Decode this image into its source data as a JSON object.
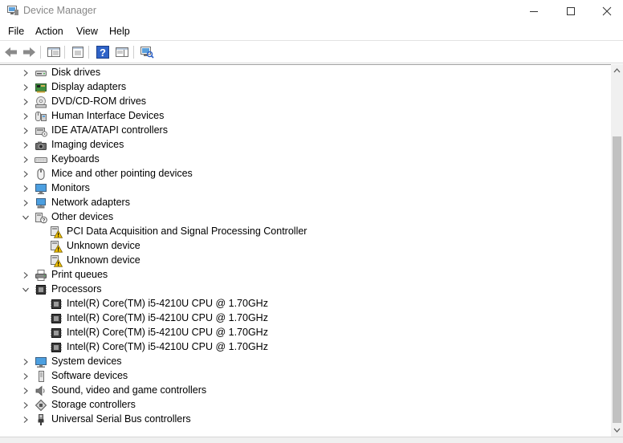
{
  "window": {
    "title": "Device Manager",
    "app_icon": "device-manager-icon"
  },
  "menu": [
    {
      "label": "File"
    },
    {
      "label": "Action"
    },
    {
      "label": "View"
    },
    {
      "label": "Help"
    }
  ],
  "toolbar": {
    "buttons": [
      "back-arrow-icon",
      "forward-arrow-icon",
      "show-hide-console-tree-icon",
      "properties-icon",
      "help-icon",
      "action-pane-icon",
      "scan-hardware-icon"
    ]
  },
  "tree": [
    {
      "label": "Disk drives",
      "expanded": false,
      "level": 0,
      "icon": "disk-drive-icon"
    },
    {
      "label": "Display adapters",
      "expanded": false,
      "level": 0,
      "icon": "display-adapter-icon"
    },
    {
      "label": "DVD/CD-ROM drives",
      "expanded": false,
      "level": 0,
      "icon": "dvd-drive-icon"
    },
    {
      "label": "Human Interface Devices",
      "expanded": false,
      "level": 0,
      "icon": "hid-icon"
    },
    {
      "label": "IDE ATA/ATAPI controllers",
      "expanded": false,
      "level": 0,
      "icon": "ide-controller-icon"
    },
    {
      "label": "Imaging devices",
      "expanded": false,
      "level": 0,
      "icon": "camera-icon"
    },
    {
      "label": "Keyboards",
      "expanded": false,
      "level": 0,
      "icon": "keyboard-icon"
    },
    {
      "label": "Mice and other pointing devices",
      "expanded": false,
      "level": 0,
      "icon": "mouse-icon"
    },
    {
      "label": "Monitors",
      "expanded": false,
      "level": 0,
      "icon": "monitor-icon"
    },
    {
      "label": "Network adapters",
      "expanded": false,
      "level": 0,
      "icon": "network-adapter-icon"
    },
    {
      "label": "Other devices",
      "expanded": true,
      "level": 0,
      "icon": "other-devices-icon"
    },
    {
      "label": "PCI Data Acquisition and Signal Processing Controller",
      "level": 1,
      "icon": "warning-device-icon"
    },
    {
      "label": "Unknown device",
      "level": 1,
      "icon": "warning-device-icon"
    },
    {
      "label": "Unknown device",
      "level": 1,
      "icon": "warning-device-icon"
    },
    {
      "label": "Print queues",
      "expanded": false,
      "level": 0,
      "icon": "printer-icon"
    },
    {
      "label": "Processors",
      "expanded": true,
      "level": 0,
      "icon": "processor-icon"
    },
    {
      "label": "Intel(R) Core(TM) i5-4210U CPU @ 1.70GHz",
      "level": 1,
      "icon": "processor-icon"
    },
    {
      "label": "Intel(R) Core(TM) i5-4210U CPU @ 1.70GHz",
      "level": 1,
      "icon": "processor-icon"
    },
    {
      "label": "Intel(R) Core(TM) i5-4210U CPU @ 1.70GHz",
      "level": 1,
      "icon": "processor-icon"
    },
    {
      "label": "Intel(R) Core(TM) i5-4210U CPU @ 1.70GHz",
      "level": 1,
      "icon": "processor-icon"
    },
    {
      "label": "System devices",
      "expanded": false,
      "level": 0,
      "icon": "system-devices-icon"
    },
    {
      "label": "Software devices",
      "expanded": false,
      "level": 0,
      "icon": "software-device-icon"
    },
    {
      "label": "Sound, video and game controllers",
      "expanded": false,
      "level": 0,
      "icon": "speaker-icon"
    },
    {
      "label": "Storage controllers",
      "expanded": false,
      "level": 0,
      "icon": "storage-controller-icon"
    },
    {
      "label": "Universal Serial Bus controllers",
      "expanded": false,
      "level": 0,
      "icon": "usb-icon"
    }
  ],
  "colors": {
    "title_text": "#888888",
    "scroll_thumb": "#c1c1c1",
    "warning": "#f2c200"
  }
}
